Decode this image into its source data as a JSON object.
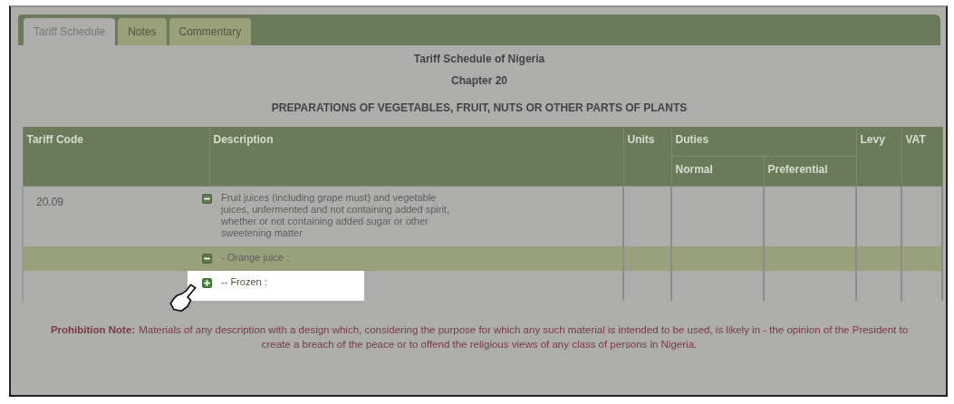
{
  "tabs": [
    {
      "label": "Tariff Schedule",
      "selected": true
    },
    {
      "label": "Notes",
      "selected": false
    },
    {
      "label": "Commentary",
      "selected": false
    }
  ],
  "heading": {
    "title": "Tariff Schedule of Nigeria",
    "chapter": "Chapter 20",
    "subtitle": "PREPARATIONS OF VEGETABLES, FRUIT, NUTS OR OTHER PARTS OF PLANTS"
  },
  "table": {
    "columns": {
      "code": "Tariff Code",
      "description": "Description",
      "units": "Units",
      "duties": "Duties",
      "normal": "Normal",
      "preferential": "Preferential",
      "levy": "Levy",
      "vat": "VAT"
    },
    "rows": [
      {
        "code": "20.09",
        "description": "Fruit juices (including grape must) and vegetable juices, unfermented and not containing added spirit, whether or not containing added sugar or other sweetening matter",
        "expanded": true,
        "selected": false,
        "spotlight": false
      },
      {
        "description": "- Orange juice :",
        "expanded": true,
        "selected": true,
        "spotlight": false
      },
      {
        "description": "-- Frozen :",
        "expanded": false,
        "selected": false,
        "spotlight": true
      }
    ]
  },
  "prohibition_note": {
    "label": "Prohibition Note:",
    "text": "Materials of any description with a design which, considering the purpose for which any such material is intended to be used, is likely in - the opinion of the President to create a breach of the peace or to offend the religious views of any class of persons in Nigeria."
  }
}
